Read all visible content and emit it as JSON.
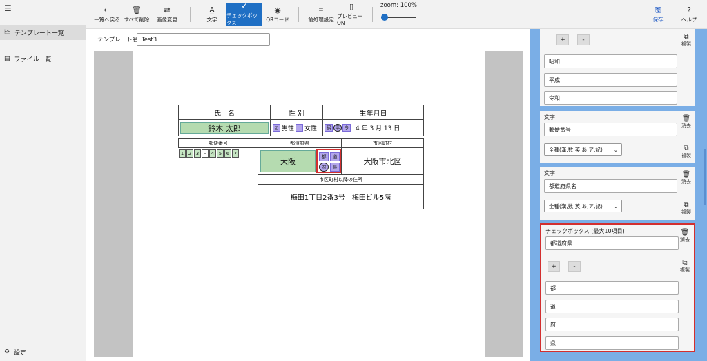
{
  "sidebar": {
    "items": [
      {
        "label": "テンプレート一覧",
        "icon": "template-icon"
      },
      {
        "label": "ファイル一覧",
        "icon": "file-icon"
      }
    ],
    "settings_label": "設定"
  },
  "toolbar": {
    "back": "一覧へ戻る",
    "delete_all": "すべて削除",
    "change_image": "画像変更",
    "text": "文字",
    "checkbox": "チェックボックス",
    "qrcode": "QRコード",
    "preprocess": "前処理設定",
    "preview": "プレビューON",
    "zoom": "zoom: 100%",
    "zoom_percent": 100,
    "save": "保存",
    "help": "ヘルプ",
    "accent": "#1f6fc4"
  },
  "template": {
    "name_label": "テンプレート名：",
    "name_value": "Test3"
  },
  "form": {
    "name_header": "氏　名",
    "gender_header": "性 別",
    "birth_header": "生年月日",
    "name_value": "鈴木 太郎",
    "male": "男性",
    "female": "女性",
    "era1": "昭",
    "era2": "平",
    "era3": "令",
    "birth_rest": "4 年 3 月 13 日",
    "postal_header": "郵便番号",
    "pref_header": "都道府県",
    "city_header": "市区町村",
    "postal_digits": [
      "1",
      "2",
      "3",
      "-",
      "4",
      "5",
      "6",
      "7"
    ],
    "pref_value": "大阪",
    "pref_opts": [
      "都",
      "道",
      "府",
      "県"
    ],
    "city_value": "大阪市北区",
    "addr_header": "市区町村以降の住所",
    "addr_value": "梅田1丁目2番3号　梅田ビル5階"
  },
  "panel": {
    "top_card": {
      "plus": "+",
      "minus": "-",
      "copy": "複製",
      "options": [
        "昭和",
        "平成",
        "令和"
      ]
    },
    "text_card1": {
      "type": "文字",
      "field": "郵便番号",
      "delete": "消去",
      "charset": "全種(漢,数,英,あ,ア,記)",
      "copy": "複製"
    },
    "text_card2": {
      "type": "文字",
      "field": "都道府県名",
      "delete": "消去",
      "charset": "全種(漢,数,英,あ,ア,記)",
      "copy": "複製"
    },
    "check_card": {
      "type": "チェックボックス (最大10項目)",
      "field": "都道府県",
      "delete": "消去",
      "plus": "+",
      "minus": "-",
      "copy": "複製",
      "options": [
        "都",
        "道",
        "府",
        "県"
      ],
      "highlight": "#d32f2f"
    }
  }
}
